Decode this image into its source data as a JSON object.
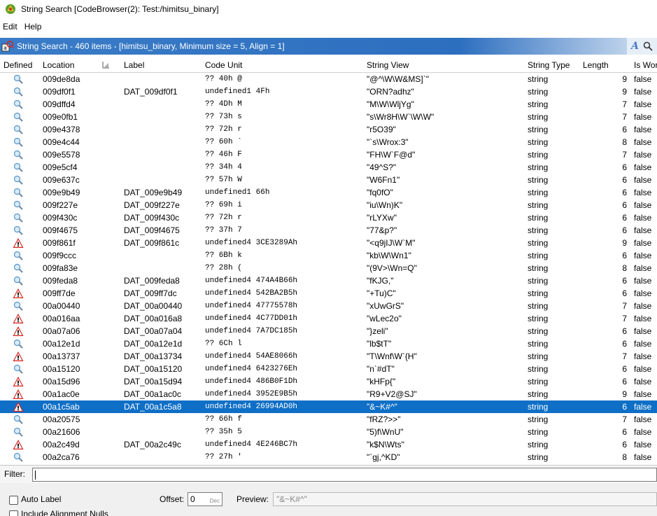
{
  "window": {
    "title": "String Search [CodeBrowser(2): Test:/himitsu_binary]"
  },
  "menu": {
    "items": [
      "Edit",
      "Help"
    ]
  },
  "provider": {
    "title": "String Search - 460 items - [himitsu_binary, Minimum size = 5, Align = 1]",
    "tool_a": "A"
  },
  "columns": {
    "defined": "Defined",
    "location": "Location",
    "label": "Label",
    "code_unit": "Code Unit",
    "string_view": "String View",
    "string_type": "String Type",
    "length": "Length",
    "is_word": "Is Wor"
  },
  "colors": {
    "selection": "#0f6fc6",
    "header_blue": "#2d6fbf",
    "warning_red": "#d9231e"
  },
  "rows": [
    {
      "icon": "magnifier",
      "location": "009de8da",
      "label": "",
      "code": "?? 40h    @",
      "view": "\"@^\\W\\W&MS]`\"",
      "type": "string",
      "length": "9",
      "word": "false"
    },
    {
      "icon": "magnifier",
      "location": "009df0f1",
      "label": "DAT_009df0f1",
      "code": "undefined1 4Fh",
      "view": "\"ORN?adhz\"",
      "type": "string",
      "length": "9",
      "word": "false"
    },
    {
      "icon": "magnifier",
      "location": "009dffd4",
      "label": "",
      "code": "?? 4Dh    M",
      "view": "\"M\\W\\WljYg\"",
      "type": "string",
      "length": "7",
      "word": "false"
    },
    {
      "icon": "magnifier",
      "location": "009e0fb1",
      "label": "",
      "code": "?? 73h    s",
      "view": "\"s\\Wr8H\\W`\\W\\W\"",
      "type": "string",
      "length": "7",
      "word": "false"
    },
    {
      "icon": "magnifier",
      "location": "009e4378",
      "label": "",
      "code": "?? 72h    r",
      "view": "\"r5O39\"",
      "type": "string",
      "length": "6",
      "word": "false"
    },
    {
      "icon": "magnifier",
      "location": "009e4c44",
      "label": "",
      "code": "?? 60h    `",
      "view": "\"`s\\Wrox:3\"",
      "type": "string",
      "length": "8",
      "word": "false"
    },
    {
      "icon": "magnifier",
      "location": "009e5578",
      "label": "",
      "code": "?? 46h    F",
      "view": "\"FH\\W`F@d\"",
      "type": "string",
      "length": "7",
      "word": "false"
    },
    {
      "icon": "magnifier",
      "location": "009e5cf4",
      "label": "",
      "code": "?? 34h    4",
      "view": "\"49^S?\"",
      "type": "string",
      "length": "6",
      "word": "false"
    },
    {
      "icon": "magnifier",
      "location": "009e637c",
      "label": "",
      "code": "?? 57h    W",
      "view": "\"W6Fn1\"",
      "type": "string",
      "length": "6",
      "word": "false"
    },
    {
      "icon": "magnifier",
      "location": "009e9b49",
      "label": "DAT_009e9b49",
      "code": "undefined1 66h",
      "view": "\"fq0fO\"",
      "type": "string",
      "length": "6",
      "word": "false"
    },
    {
      "icon": "magnifier",
      "location": "009f227e",
      "label": "DAT_009f227e",
      "code": "?? 69h    i",
      "view": "\"iu\\Wn)K\"",
      "type": "string",
      "length": "6",
      "word": "false"
    },
    {
      "icon": "magnifier",
      "location": "009f430c",
      "label": "DAT_009f430c",
      "code": "?? 72h    r",
      "view": "\"rLYXw\"",
      "type": "string",
      "length": "6",
      "word": "false"
    },
    {
      "icon": "magnifier",
      "location": "009f4675",
      "label": "DAT_009f4675",
      "code": "?? 37h    7",
      "view": "\"77&p?\"",
      "type": "string",
      "length": "6",
      "word": "false"
    },
    {
      "icon": "warning",
      "location": "009f861f",
      "label": "DAT_009f861c",
      "code": "undefined4 3CE3289Ah",
      "view": "\"<q9jIJ\\W`M\"",
      "type": "string",
      "length": "9",
      "word": "false"
    },
    {
      "icon": "magnifier",
      "location": "009f9ccc",
      "label": "",
      "code": "?? 6Bh    k",
      "view": "\"kb\\W\\Wn1\"",
      "type": "string",
      "length": "6",
      "word": "false"
    },
    {
      "icon": "magnifier",
      "location": "009fa83e",
      "label": "",
      "code": "?? 28h    (",
      "view": "\"(9V>\\Wn=Q\"",
      "type": "string",
      "length": "8",
      "word": "false"
    },
    {
      "icon": "magnifier",
      "location": "009feda8",
      "label": "DAT_009feda8",
      "code": "undefined4 474A4B66h",
      "view": "\"fKJG,\"",
      "type": "string",
      "length": "6",
      "word": "false"
    },
    {
      "icon": "warning",
      "location": "009ff7de",
      "label": "DAT_009ff7dc",
      "code": "undefined4 542BA2B5h",
      "view": "\"+Tu)C\"",
      "type": "string",
      "length": "6",
      "word": "false"
    },
    {
      "icon": "magnifier",
      "location": "00a00440",
      "label": "DAT_00a00440",
      "code": "undefined4 47775578h",
      "view": "\"xUwGrS\"",
      "type": "string",
      "length": "7",
      "word": "false"
    },
    {
      "icon": "warning",
      "location": "00a016aa",
      "label": "DAT_00a016a8",
      "code": "undefined4 4C77DD01h",
      "view": "\"wLec2o\"",
      "type": "string",
      "length": "7",
      "word": "false"
    },
    {
      "icon": "warning",
      "location": "00a07a06",
      "label": "DAT_00a07a04",
      "code": "undefined4 7A7DC185h",
      "view": "\"}zeli\"",
      "type": "string",
      "length": "6",
      "word": "false"
    },
    {
      "icon": "magnifier",
      "location": "00a12e1d",
      "label": "DAT_00a12e1d",
      "code": "?? 6Ch    l",
      "view": "\"lb$tT\"",
      "type": "string",
      "length": "6",
      "word": "false"
    },
    {
      "icon": "warning",
      "location": "00a13737",
      "label": "DAT_00a13734",
      "code": "undefined4 54AE8066h",
      "view": "\"T\\Wnf\\W`{H\"",
      "type": "string",
      "length": "7",
      "word": "false"
    },
    {
      "icon": "magnifier",
      "location": "00a15120",
      "label": "DAT_00a15120",
      "code": "undefined4 6423276Eh",
      "view": "\"n`#dT\"",
      "type": "string",
      "length": "6",
      "word": "false"
    },
    {
      "icon": "warning",
      "location": "00a15d96",
      "label": "DAT_00a15d94",
      "code": "undefined4 486B0F1Dh",
      "view": "\"kHFp{\"",
      "type": "string",
      "length": "6",
      "word": "false"
    },
    {
      "icon": "warning",
      "location": "00a1ac0e",
      "label": "DAT_00a1ac0c",
      "code": "undefined4 3952E9B5h",
      "view": "\"R9+V2@SJ\"",
      "type": "string",
      "length": "9",
      "word": "false"
    },
    {
      "icon": "warning",
      "location": "00a1c5ab",
      "label": "DAT_00a1c5a8",
      "code": "undefined4 26994AD0h",
      "view": "\"&~K#^\"",
      "type": "string",
      "length": "6",
      "word": "false",
      "selected": true
    },
    {
      "icon": "magnifier",
      "location": "00a20575",
      "label": "",
      "code": "?? 66h    f",
      "view": "\"fRZ?>>\"",
      "type": "string",
      "length": "7",
      "word": "false"
    },
    {
      "icon": "magnifier",
      "location": "00a21606",
      "label": "",
      "code": "?? 35h    5",
      "view": "\"5)f\\WnU\"",
      "type": "string",
      "length": "6",
      "word": "false"
    },
    {
      "icon": "warning",
      "location": "00a2c49d",
      "label": "DAT_00a2c49c",
      "code": "undefined4 4E246BC7h",
      "view": "\"k$N\\Wts\"",
      "type": "string",
      "length": "6",
      "word": "false"
    },
    {
      "icon": "magnifier",
      "location": "00a2ca76",
      "label": "",
      "code": "?? 27h    '",
      "view": "\"`gj,^KD\"",
      "type": "string",
      "length": "8",
      "word": "false"
    }
  ],
  "filter": {
    "label": "Filter:",
    "value": ""
  },
  "options": {
    "auto_label": "Auto Label",
    "include_alignment_nulls": "Include Alignment Nulls",
    "offset_label": "Offset:",
    "offset_value": "0",
    "offset_unit": "Dec",
    "preview_label": "Preview:",
    "preview_value": "\"&~K#^\""
  }
}
